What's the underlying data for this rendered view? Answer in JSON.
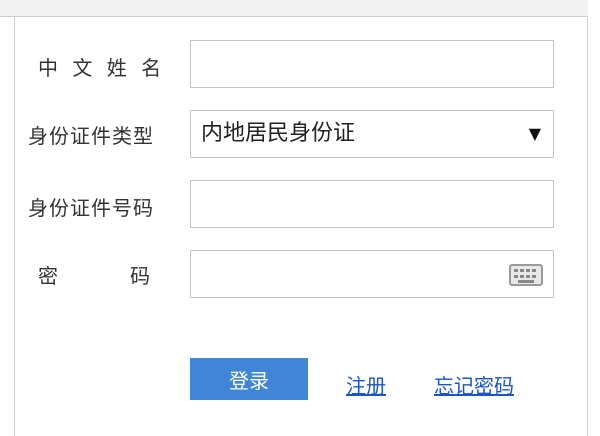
{
  "form": {
    "name_label": "中 文  姓 名",
    "name_value": "",
    "id_type_label": "身份证件类型",
    "id_type_selected": "内地居民身份证",
    "id_type_arrow": "▼",
    "id_number_label": "身份证件号码",
    "id_number_value": "",
    "password_label_first": "密",
    "password_label_second": "码",
    "password_value": ""
  },
  "actions": {
    "login_label": "登录",
    "register_label": "注册",
    "forgot_label": "忘记密码"
  },
  "icons": {
    "dropdown": "chevron-down-icon",
    "keyboard": "keyboard-icon"
  },
  "colors": {
    "login_bg": "#3f86d6",
    "link": "#1a55c8",
    "border": "#c6c6c6"
  }
}
